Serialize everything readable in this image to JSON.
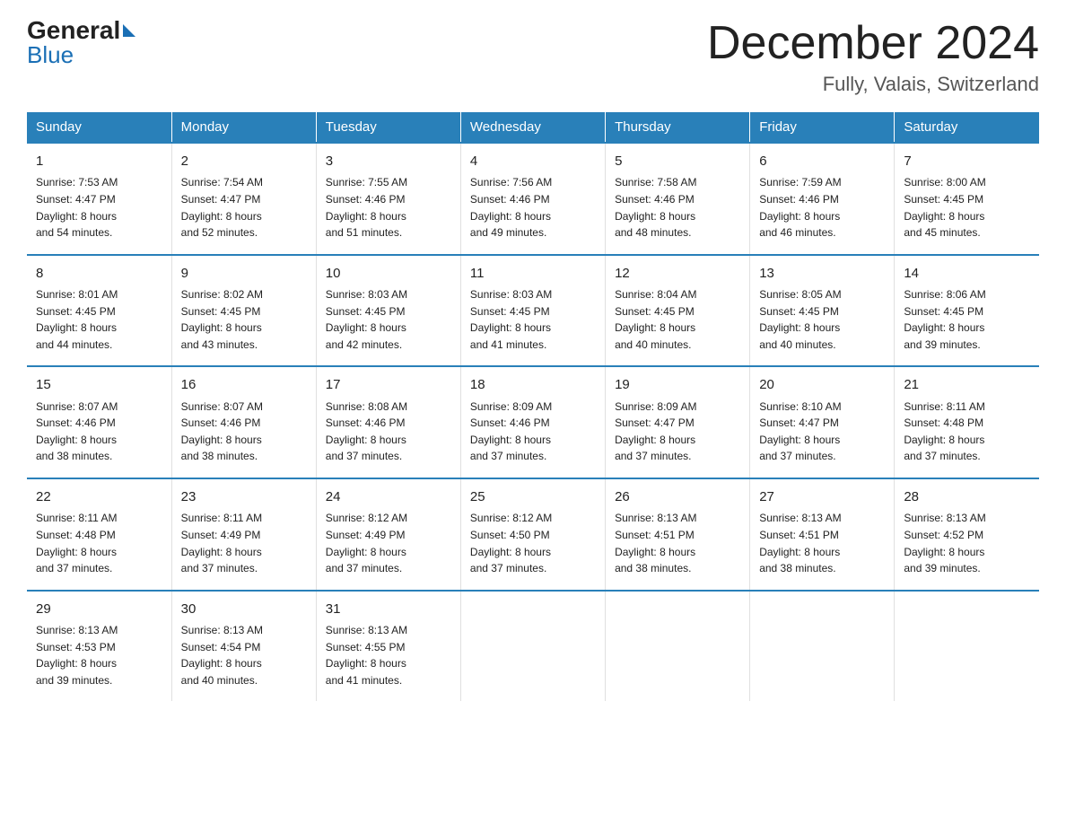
{
  "logo": {
    "general": "General",
    "blue": "Blue"
  },
  "title": "December 2024",
  "location": "Fully, Valais, Switzerland",
  "days_of_week": [
    "Sunday",
    "Monday",
    "Tuesday",
    "Wednesday",
    "Thursday",
    "Friday",
    "Saturday"
  ],
  "weeks": [
    [
      {
        "day": "1",
        "sunrise": "7:53 AM",
        "sunset": "4:47 PM",
        "daylight": "8 hours and 54 minutes."
      },
      {
        "day": "2",
        "sunrise": "7:54 AM",
        "sunset": "4:47 PM",
        "daylight": "8 hours and 52 minutes."
      },
      {
        "day": "3",
        "sunrise": "7:55 AM",
        "sunset": "4:46 PM",
        "daylight": "8 hours and 51 minutes."
      },
      {
        "day": "4",
        "sunrise": "7:56 AM",
        "sunset": "4:46 PM",
        "daylight": "8 hours and 49 minutes."
      },
      {
        "day": "5",
        "sunrise": "7:58 AM",
        "sunset": "4:46 PM",
        "daylight": "8 hours and 48 minutes."
      },
      {
        "day": "6",
        "sunrise": "7:59 AM",
        "sunset": "4:46 PM",
        "daylight": "8 hours and 46 minutes."
      },
      {
        "day": "7",
        "sunrise": "8:00 AM",
        "sunset": "4:45 PM",
        "daylight": "8 hours and 45 minutes."
      }
    ],
    [
      {
        "day": "8",
        "sunrise": "8:01 AM",
        "sunset": "4:45 PM",
        "daylight": "8 hours and 44 minutes."
      },
      {
        "day": "9",
        "sunrise": "8:02 AM",
        "sunset": "4:45 PM",
        "daylight": "8 hours and 43 minutes."
      },
      {
        "day": "10",
        "sunrise": "8:03 AM",
        "sunset": "4:45 PM",
        "daylight": "8 hours and 42 minutes."
      },
      {
        "day": "11",
        "sunrise": "8:03 AM",
        "sunset": "4:45 PM",
        "daylight": "8 hours and 41 minutes."
      },
      {
        "day": "12",
        "sunrise": "8:04 AM",
        "sunset": "4:45 PM",
        "daylight": "8 hours and 40 minutes."
      },
      {
        "day": "13",
        "sunrise": "8:05 AM",
        "sunset": "4:45 PM",
        "daylight": "8 hours and 40 minutes."
      },
      {
        "day": "14",
        "sunrise": "8:06 AM",
        "sunset": "4:45 PM",
        "daylight": "8 hours and 39 minutes."
      }
    ],
    [
      {
        "day": "15",
        "sunrise": "8:07 AM",
        "sunset": "4:46 PM",
        "daylight": "8 hours and 38 minutes."
      },
      {
        "day": "16",
        "sunrise": "8:07 AM",
        "sunset": "4:46 PM",
        "daylight": "8 hours and 38 minutes."
      },
      {
        "day": "17",
        "sunrise": "8:08 AM",
        "sunset": "4:46 PM",
        "daylight": "8 hours and 37 minutes."
      },
      {
        "day": "18",
        "sunrise": "8:09 AM",
        "sunset": "4:46 PM",
        "daylight": "8 hours and 37 minutes."
      },
      {
        "day": "19",
        "sunrise": "8:09 AM",
        "sunset": "4:47 PM",
        "daylight": "8 hours and 37 minutes."
      },
      {
        "day": "20",
        "sunrise": "8:10 AM",
        "sunset": "4:47 PM",
        "daylight": "8 hours and 37 minutes."
      },
      {
        "day": "21",
        "sunrise": "8:11 AM",
        "sunset": "4:48 PM",
        "daylight": "8 hours and 37 minutes."
      }
    ],
    [
      {
        "day": "22",
        "sunrise": "8:11 AM",
        "sunset": "4:48 PM",
        "daylight": "8 hours and 37 minutes."
      },
      {
        "day": "23",
        "sunrise": "8:11 AM",
        "sunset": "4:49 PM",
        "daylight": "8 hours and 37 minutes."
      },
      {
        "day": "24",
        "sunrise": "8:12 AM",
        "sunset": "4:49 PM",
        "daylight": "8 hours and 37 minutes."
      },
      {
        "day": "25",
        "sunrise": "8:12 AM",
        "sunset": "4:50 PM",
        "daylight": "8 hours and 37 minutes."
      },
      {
        "day": "26",
        "sunrise": "8:13 AM",
        "sunset": "4:51 PM",
        "daylight": "8 hours and 38 minutes."
      },
      {
        "day": "27",
        "sunrise": "8:13 AM",
        "sunset": "4:51 PM",
        "daylight": "8 hours and 38 minutes."
      },
      {
        "day": "28",
        "sunrise": "8:13 AM",
        "sunset": "4:52 PM",
        "daylight": "8 hours and 39 minutes."
      }
    ],
    [
      {
        "day": "29",
        "sunrise": "8:13 AM",
        "sunset": "4:53 PM",
        "daylight": "8 hours and 39 minutes."
      },
      {
        "day": "30",
        "sunrise": "8:13 AM",
        "sunset": "4:54 PM",
        "daylight": "8 hours and 40 minutes."
      },
      {
        "day": "31",
        "sunrise": "8:13 AM",
        "sunset": "4:55 PM",
        "daylight": "8 hours and 41 minutes."
      },
      null,
      null,
      null,
      null
    ]
  ],
  "labels": {
    "sunrise": "Sunrise:",
    "sunset": "Sunset:",
    "daylight": "Daylight:"
  }
}
